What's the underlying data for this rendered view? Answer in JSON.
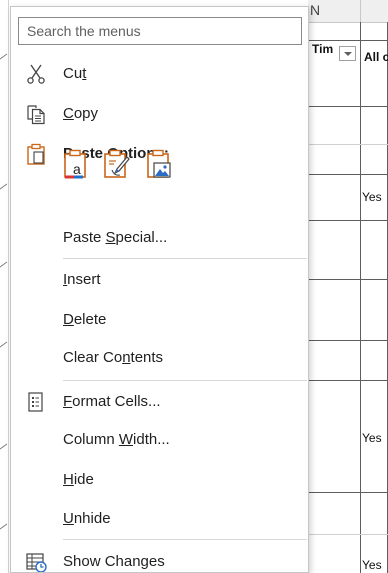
{
  "sheet": {
    "column_headers": [
      "N",
      ""
    ],
    "header_row": {
      "col_n": "Tim",
      "col_o": "All c"
    },
    "cells": [
      "Yes",
      "Yes",
      "Yes"
    ]
  },
  "context_menu": {
    "search": {
      "placeholder": "Search the menus",
      "value": ""
    },
    "items": [
      {
        "id": "cut",
        "pre": "Cu",
        "mnemonic": "t",
        "post": "",
        "icon": "scissors-icon"
      },
      {
        "id": "copy",
        "pre": "",
        "mnemonic": "C",
        "post": "opy",
        "icon": "copy-icon"
      },
      {
        "id": "paste-options",
        "label": "Paste Options:",
        "icon": "clipboard-icon"
      },
      {
        "id": "paste-special",
        "pre": "Paste ",
        "mnemonic": "S",
        "post": "pecial...",
        "icon": ""
      },
      {
        "id": "insert",
        "pre": "",
        "mnemonic": "I",
        "post": "nsert",
        "icon": ""
      },
      {
        "id": "delete",
        "pre": "",
        "mnemonic": "D",
        "post": "elete",
        "icon": ""
      },
      {
        "id": "clear-contents",
        "pre": "Clear Co",
        "mnemonic": "n",
        "post": "tents",
        "icon": ""
      },
      {
        "id": "format-cells",
        "pre": "",
        "mnemonic": "F",
        "post": "ormat Cells...",
        "icon": "format-cells-icon"
      },
      {
        "id": "column-width",
        "pre": "Column ",
        "mnemonic": "W",
        "post": "idth...",
        "icon": ""
      },
      {
        "id": "hide",
        "pre": "",
        "mnemonic": "H",
        "post": "ide",
        "icon": ""
      },
      {
        "id": "unhide",
        "pre": "",
        "mnemonic": "U",
        "post": "nhide",
        "icon": ""
      },
      {
        "id": "show-changes",
        "label": "Show Changes",
        "icon": "show-changes-icon"
      }
    ],
    "paste_options": [
      {
        "name": "paste-values-icon",
        "glyph": "a"
      },
      {
        "name": "paste-formatting-icon"
      },
      {
        "name": "paste-picture-icon"
      }
    ]
  },
  "colors": {
    "accent_orange": "#c9661a",
    "accent_blue": "#2b6cc4",
    "text": "#1f1f1f"
  }
}
